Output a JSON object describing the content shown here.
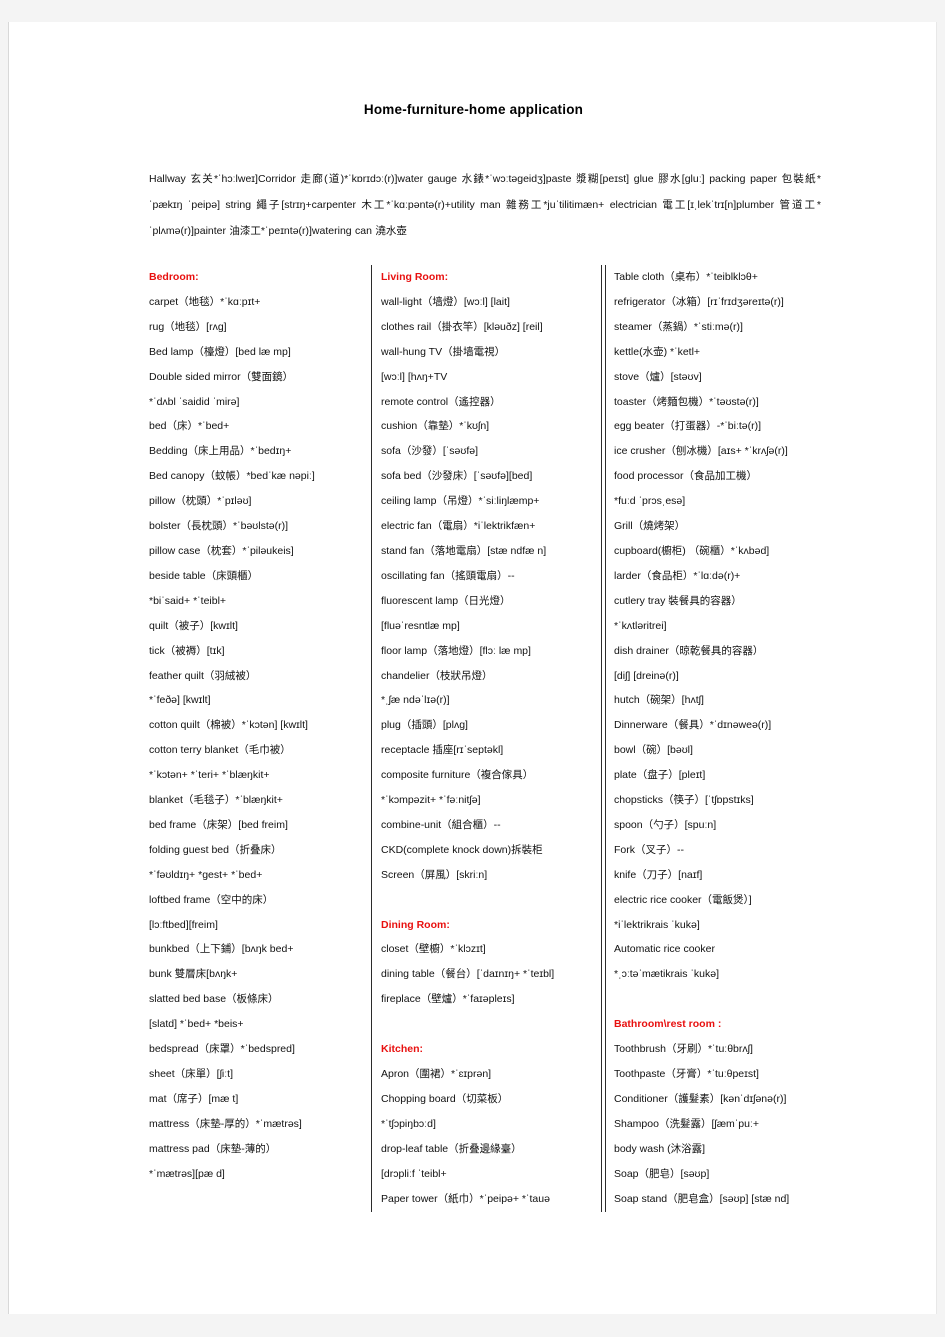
{
  "document": {
    "title": "Home-furniture-home  application",
    "intro": "Hallway 玄关*ˈhɔːlweɪ]Corridor  走廊(道)*ˈkɒrɪdɔː(r)]water gauge 水錶*ˈwɔːtəgeidʒ]paste 漿糊[peɪst]   glue 膠水[gluː] packing paper 包裝紙*ˈpækɪŋ ˈpeipə]  string 繩子[strɪŋ+carpenter  木工*ˈkɑːpəntə(r)+utility man  雜務工*juˈtilitimæn+ electrician  電工[ɪˌlekˈtrɪ[n]plumber  管道工*ˈplʌmə(r)]painter  油漆工*ˈpeɪntə(r)]watering can 澆水壺",
    "heading_color": "#e8100f"
  },
  "columns": [
    {
      "id": "column-1",
      "blocks": [
        {
          "heading": "Bedroom:",
          "entries": [
            "carpet（地毯）*ˈkɑːpɪt+",
            "rug（地毯）[rʌg]",
            "Bed lamp（檯燈）[bed læ mp]",
            "Double sided mirror（雙面鏡）",
            "*ˈdʌbl ˈsaidid ˈmirə]",
            "bed（床）*ˈbed+",
            "Bedding（床上用品）*ˈbedɪŋ+",
            "Bed canopy（蚊帳）*bedˈkæ nəpiː]",
            "pillow（枕頭）*ˈpɪləʊ]",
            "bolster（長枕頭）*ˈbəʊlstə(r)]",
            "pillow case（枕套）*ˈpiləukeis]",
            "beside table（床頭櫃）",
            "*biˈsaid+ *ˈteibl+",
            "quilt（被子）[kwɪlt]",
            "tick（被褥）[tɪk]",
            "feather quilt（羽絨被）",
            "*ˈfeðə] [kwɪlt]",
            "cotton quilt（棉被）*ˈkɔtən] [kwɪlt]",
            "cotton terry blanket（毛巾被）",
            "*ˈkɔtən+ *ˈteri+ *ˈblæŋkit+",
            "blanket（毛毯子）*ˈblæŋkit+",
            "bed frame（床架）[bed freim]",
            "folding guest bed（折叠床）",
            "*ˈfəʊldɪŋ+ *gest+ *ˈbed+",
            "loftbed frame（空中的床）",
            "[lɔːftbed][freim]",
            "bunkbed（上下鋪）[bʌŋk bed+",
            "bunk  雙層床[bʌŋk+",
            "slatted bed base（板條床）",
            "[slatd] *ˈbed+ *beis+",
            "bedspread（床罩）*ˈbedspred]",
            "sheet（床單）[ʃiːt]",
            "mat（席子）[mæ t]",
            "mattress（床墊-厚的）*ˈmætrəs]",
            "mattress pad（床墊-薄的）",
            "*ˈmætrəs][pæ d]"
          ]
        }
      ]
    },
    {
      "id": "column-2",
      "blocks": [
        {
          "heading": "Living Room:",
          "entries": [
            "wall-light（墙燈）[wɔːl] [lait]",
            "clothes rail（掛衣竿）[kləuðz] [reil]",
            "wall-hung TV（掛墙電視）",
            "[wɔːl] [hʌŋ+TV",
            "remote control（遙控器）",
            "cushion（靠墊）*ˈkʊʃn]",
            "sofa（沙發）[ˈsəʊfə]",
            "sofa bed（沙發床）[ˈsəʊfə][bed]",
            "ceiling lamp（吊燈）*ˈsiːliŋlæmp+",
            "electric fan（電扇）*iˈlektrikfæn+",
            "stand fan（落地電扇）[stæ ndfæ n]",
            "oscillating fan（搖頭電扇）--",
            "fluorescent lamp（日光燈）",
            "[fluəˈresntlæ mp]",
            "floor lamp（落地燈）[flɔː læ mp]",
            "chandelier（枝狀吊燈）",
            "*ˌʃæ ndəˈlɪə(r)]",
            "plug（插頭）[plʌg]",
            "receptacle  插座[rɪˈseptəkl]",
            "composite furniture（複合傢具）",
            "*ˈkɔmpəzit+ *ˈfəːnitʃə]",
            "combine-unit（組合櫃）--",
            "CKD(complete knock down)拆裝柜",
            "Screen（屏風）[skriːn]"
          ]
        },
        {
          "heading": "Dining Room:",
          "entries": [
            "closet（壁櫥）*ˈklɔzɪt]",
            "dining table（餐台）[ˈdaɪnɪŋ+ *ˈteɪbl]",
            "fireplace（壁爐）*ˈfaɪəpleɪs]"
          ]
        },
        {
          "heading": "Kitchen:",
          "entries": [
            "Apron（圍裙）*ˈɛɪprən]",
            "Chopping board（切菜板）",
            "*ˈtʃɔpiŋbɔːd]",
            "drop-leaf table（折叠邊緣臺）",
            "[drɔpliːf ˈteibl+",
            "Paper tower（紙巾）*ˈpeipə+ *ˈtauə"
          ]
        }
      ]
    },
    {
      "id": "column-3",
      "blocks": [
        {
          "heading": "",
          "entries": [
            "Table cloth（桌布）*ˈteiblklɔθ+",
            "refrigerator（冰箱）[rɪˈfrɪdʒəreɪtə(r)]",
            "steamer（蒸鍋）*ˈstiːmə(r)]",
            "kettle(水壶) *ˈketl+",
            "stove（爐）[stəʊv]",
            "toaster（烤麵包機）*ˈtəʊstə(r)]",
            "egg beater（打蛋器）-*ˈbiːtə(r)]",
            "ice crusher（刨冰機）[aɪs+ *ˈkrʌʃə(r)]",
            "food processor（食品加工機）",
            "*fuːd ˈprɔsˌesə]",
            "Grill（燒烤架）",
            "cupboard(櫥柜) （碗櫃）*ˈkʌbəd]",
            "larder（食品柜）*ˈlɑːdə(r)+",
            "cutlery tray 裝餐具的容器）",
            "*ˈkʌtləritrei]",
            "dish drainer（晾乾餐具的容器）",
            "[diʃ] [dreinə(r)]",
            "hutch（碗架）[hʌtʃ]",
            "Dinnerware（餐具）*ˈdɪnəweə(r)]",
            "bowl（碗）[bəʊl]",
            "plate（盘子）[pleɪt]",
            "chopsticks（筷子）[ˈtʃɒpstɪks]",
            "spoon（勺子）[spuːn]",
            "Fork（叉子）--",
            "knife（刀子）[naɪf]",
            "electric rice cooker（電飯煲）]",
            "*iˈlektrikrais ˈkukə]",
            "Automatic rice cooker",
            "*ˌɔːtəˈmætikrais ˈkukə]"
          ]
        },
        {
          "heading": "Bathroom\\rest room :",
          "entries": [
            "Toothbrush（牙刷）*ˈtuːθbrʌʃ]",
            "Toothpaste（牙膏）*ˈtuːθpeɪst]",
            "Conditioner（護髮素）[kənˈdɪʃənə(r)]",
            "Shampoo（洗髮露）[ʃæmˈpuː+",
            "body wash (沐浴露]",
            "Soap（肥皂）[səʊp]",
            "Soap stand（肥皂盒）[səʊp] [stæ nd]"
          ]
        }
      ]
    }
  ]
}
